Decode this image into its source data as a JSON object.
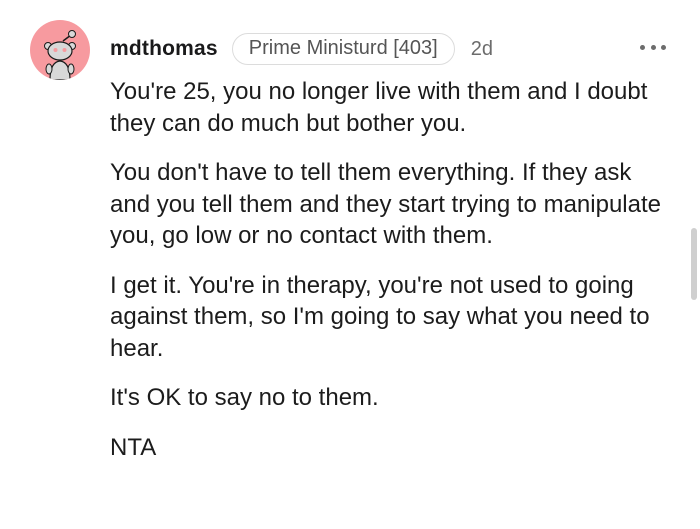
{
  "comment": {
    "author": "mdthomas",
    "flair": "Prime Ministurd [403]",
    "age": "2d",
    "more_icon": "more-horizontal-icon",
    "avatar_color": "#f79a9f",
    "paragraphs": [
      "You're 25, you no longer live with them and I doubt they can do much but bother you.",
      "You don't have to tell them everything. If they ask and you tell them and they start trying to manipulate you, go low or no contact with them.",
      "I get it. You're in therapy, you're not used to going against them, so I'm going to say what you need to hear.",
      "It's OK to say no to them.",
      "NTA"
    ]
  }
}
